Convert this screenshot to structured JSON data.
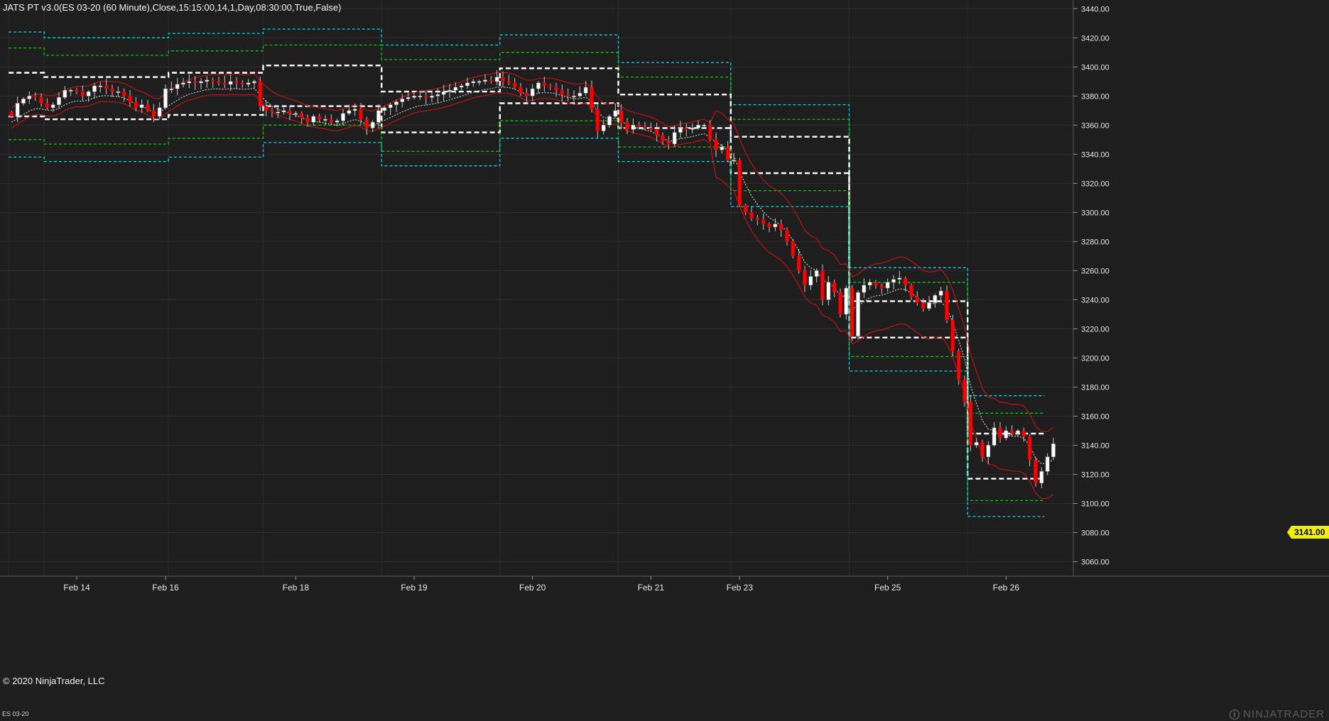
{
  "window": {
    "title": "JATS PT v3.0(ES 03-20 (60 Minute),Close,15:15:00,14,1,Day,08:30:00,True,False)",
    "copyright": "© 2020 NinjaTrader, LLC",
    "instrument": "ES 03-20",
    "brand": "NINJATRADER",
    "last_price": "3141.00"
  },
  "colors": {
    "background": "#1e1e1e",
    "grid": "#2e2e2e",
    "up_candle": "#ffffff",
    "down_candle": "#ff0000",
    "cyan_level": "#00d7e6",
    "green_level": "#00d000",
    "white_level": "#ffffff",
    "red_band": "#d01010",
    "gray_band": "#c8c8c8",
    "price_tag": "#f0f000"
  },
  "chart_data": {
    "type": "candlestick",
    "title": "JATS PT v3.0(ES 03-20 (60 Minute),Close,15:15:00,14,1,Day,08:30:00,True,False)",
    "ylim": [
      3050,
      3445
    ],
    "y_ticks": [
      "3060.00",
      "3080.00",
      "3100.00",
      "3120.00",
      "3140.00",
      "3160.00",
      "3180.00",
      "3200.00",
      "3220.00",
      "3240.00",
      "3260.00",
      "3280.00",
      "3300.00",
      "3320.00",
      "3340.00",
      "3360.00",
      "3380.00",
      "3400.00",
      "3420.00",
      "3440.00"
    ],
    "x_labels": [
      {
        "label": "Feb 14",
        "bar": 11
      },
      {
        "label": "Feb 16",
        "bar": 26
      },
      {
        "label": "Feb 18",
        "bar": 48
      },
      {
        "label": "Feb 19",
        "bar": 68
      },
      {
        "label": "Feb 20",
        "bar": 88
      },
      {
        "label": "Feb 21",
        "bar": 108
      },
      {
        "label": "Feb 23",
        "bar": 123
      },
      {
        "label": "Feb 25",
        "bar": 148
      },
      {
        "label": "Feb 26",
        "bar": 168
      }
    ],
    "sessions": [
      {
        "start": 0,
        "end": 5,
        "cyan_hi": 3424,
        "green_hi": 3413,
        "white_hi": 3396,
        "white_lo": 3366,
        "green_lo": 3350,
        "cyan_lo": 3338
      },
      {
        "start": 6,
        "end": 26,
        "cyan_hi": 3420,
        "green_hi": 3408,
        "white_hi": 3393,
        "white_lo": 3364,
        "green_lo": 3347,
        "cyan_lo": 3335
      },
      {
        "start": 27,
        "end": 42,
        "cyan_hi": 3423,
        "green_hi": 3411,
        "white_hi": 3396,
        "white_lo": 3367,
        "green_lo": 3351,
        "cyan_lo": 3338
      },
      {
        "start": 43,
        "end": 62,
        "cyan_hi": 3426,
        "green_hi": 3415,
        "white_hi": 3401,
        "white_lo": 3373,
        "green_lo": 3360,
        "cyan_lo": 3348
      },
      {
        "start": 63,
        "end": 82,
        "cyan_hi": 3415,
        "green_hi": 3405,
        "white_hi": 3383,
        "white_lo": 3355,
        "green_lo": 3342,
        "cyan_lo": 3332
      },
      {
        "start": 83,
        "end": 102,
        "cyan_hi": 3422,
        "green_hi": 3410,
        "white_hi": 3399,
        "white_lo": 3375,
        "green_lo": 3363,
        "cyan_lo": 3351
      },
      {
        "start": 103,
        "end": 121,
        "cyan_hi": 3403,
        "green_hi": 3393,
        "white_hi": 3381,
        "white_lo": 3358,
        "green_lo": 3345,
        "cyan_lo": 3335
      },
      {
        "start": 122,
        "end": 141,
        "cyan_hi": 3374,
        "green_hi": 3364,
        "white_hi": 3352,
        "white_lo": 3327,
        "green_lo": 3315,
        "cyan_lo": 3304
      },
      {
        "start": 142,
        "end": 161,
        "cyan_hi": 3262,
        "green_hi": 3252,
        "white_hi": 3239,
        "white_lo": 3214,
        "green_lo": 3201,
        "cyan_lo": 3191
      },
      {
        "start": 162,
        "end": 174,
        "cyan_hi": 3174,
        "green_hi": 3162,
        "white_hi": 3148,
        "white_lo": 3117,
        "green_lo": 3102,
        "cyan_lo": 3091
      }
    ],
    "closes": [
      3366,
      3375,
      3378,
      3380,
      3379,
      3375,
      3372,
      3374,
      3379,
      3384,
      3384,
      3383,
      3380,
      3383,
      3387,
      3387,
      3385,
      3383,
      3383,
      3380,
      3376,
      3372,
      3374,
      3370,
      3366,
      3372,
      3385,
      3385,
      3388,
      3389,
      3390,
      3389,
      3390,
      3391,
      3390,
      3389,
      3388,
      3390,
      3389,
      3388,
      3389,
      3390,
      3373,
      3370,
      3369,
      3369,
      3370,
      3368,
      3368,
      3365,
      3362,
      3366,
      3364,
      3364,
      3362,
      3363,
      3368,
      3370,
      3371,
      3364,
      3358,
      3362,
      3370,
      3372,
      3374,
      3376,
      3378,
      3379,
      3380,
      3380,
      3379,
      3380,
      3381,
      3383,
      3384,
      3386,
      3387,
      3389,
      3390,
      3390,
      3391,
      3390,
      3393,
      3390,
      3389,
      3386,
      3382,
      3380,
      3385,
      3389,
      3387,
      3386,
      3384,
      3381,
      3380,
      3380,
      3382,
      3386,
      3371,
      3356,
      3360,
      3366,
      3370,
      3362,
      3357,
      3360,
      3359,
      3358,
      3357,
      3353,
      3349,
      3347,
      3355,
      3358,
      3357,
      3358,
      3360,
      3360,
      3350,
      3343,
      3345,
      3336,
      3336,
      3305,
      3300,
      3296,
      3295,
      3292,
      3290,
      3292,
      3288,
      3280,
      3270,
      3260,
      3250,
      3256,
      3260,
      3240,
      3252,
      3245,
      3230,
      3248,
      3215,
      3245,
      3250,
      3252,
      3250,
      3248,
      3252,
      3254,
      3255,
      3250,
      3242,
      3238,
      3234,
      3238,
      3243,
      3246,
      3226,
      3205,
      3185,
      3170,
      3140,
      3142,
      3132,
      3140,
      3152,
      3145,
      3150,
      3148,
      3150,
      3146,
      3130,
      3114,
      3122,
      3132,
      3141
    ]
  }
}
